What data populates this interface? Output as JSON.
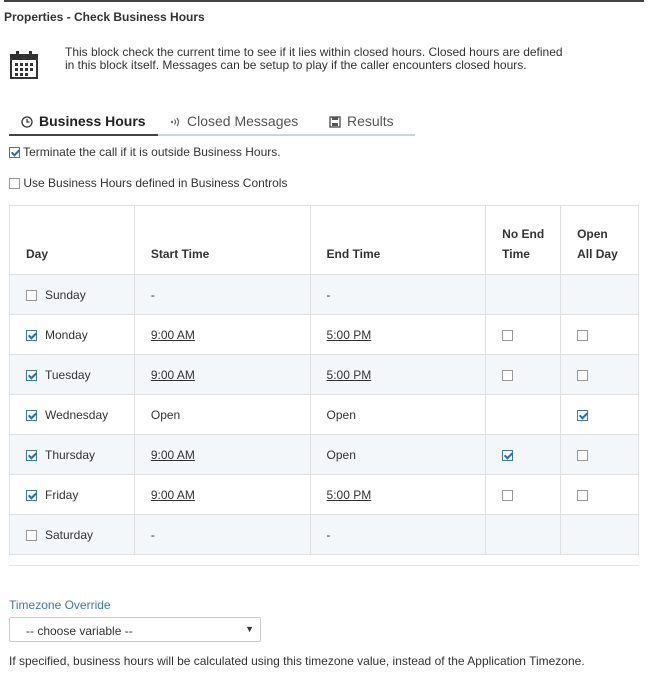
{
  "header": {
    "title": "Properties - Check Business Hours"
  },
  "description": {
    "line1": "This block check the current time to see if it lies within closed hours. Closed hours are defined",
    "line2": "in this block itself. Messages can be setup to play if the caller encounters closed hours."
  },
  "tabs": [
    {
      "label": "Business Hours",
      "icon": "clock-icon",
      "active": true
    },
    {
      "label": "Closed Messages",
      "icon": "sound-icon",
      "active": false
    },
    {
      "label": "Results",
      "icon": "save-icon",
      "active": false
    }
  ],
  "options": {
    "terminate": {
      "label": "Terminate the call if it is outside Business Hours.",
      "checked": true
    },
    "use_controls": {
      "label": "Use Business Hours defined in Business Controls",
      "checked": false
    }
  },
  "table": {
    "headers": {
      "day": "Day",
      "start": "Start Time",
      "end": "End Time",
      "no_end_1": "No End",
      "no_end_2": "Time",
      "open_all_1": "Open",
      "open_all_2": "All Day"
    },
    "rows": [
      {
        "day": "Sunday",
        "enabled": false,
        "start": "-",
        "end": "-",
        "no_end": null,
        "open_all": null
      },
      {
        "day": "Monday",
        "enabled": true,
        "start": "9:00 AM",
        "end": "5:00 PM",
        "no_end": false,
        "open_all": false
      },
      {
        "day": "Tuesday",
        "enabled": true,
        "start": "9:00 AM",
        "end": "5:00 PM",
        "no_end": false,
        "open_all": false
      },
      {
        "day": "Wednesday",
        "enabled": true,
        "start": "Open",
        "end": "Open",
        "no_end": null,
        "open_all": true
      },
      {
        "day": "Thursday",
        "enabled": true,
        "start": "9:00 AM",
        "end": "Open",
        "no_end": true,
        "open_all": false
      },
      {
        "day": "Friday",
        "enabled": true,
        "start": "9:00 AM",
        "end": "5:00 PM",
        "no_end": false,
        "open_all": false
      },
      {
        "day": "Saturday",
        "enabled": false,
        "start": "-",
        "end": "-",
        "no_end": null,
        "open_all": null
      }
    ]
  },
  "timezone": {
    "label": "Timezone Override",
    "selected": "-- choose variable --",
    "note": "If specified, business hours will be calculated using this timezone value, instead of the Application Timezone."
  },
  "colors": {
    "accent": "#3b78b4",
    "row_alt": "#f4f7fa",
    "border": "#e0e0e0"
  }
}
